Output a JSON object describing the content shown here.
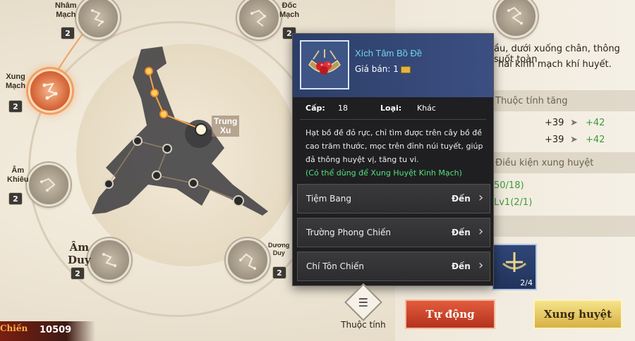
{
  "nodes": {
    "nham_mach": {
      "label": "Nhâm\nMạch",
      "level": "2"
    },
    "doc_mach": {
      "label": "Đốc\nMạch",
      "level": "2"
    },
    "xung_mach": {
      "label": "Xung\nMạch",
      "level": "2"
    },
    "am_khieu": {
      "label": "Âm\nKhiêu",
      "level": "2"
    },
    "am_duy": {
      "label": "Âm\nDuy",
      "level": "2"
    },
    "duong_duy": {
      "label": "Dương\nDuy",
      "level": "2"
    },
    "trung_xu": {
      "label": "Trung\nXu"
    }
  },
  "background": {
    "desc_line1": "ầu, dưới xuống chân, thông suốt toàn",
    "desc_line2": "hai kinh mạch khí huyết.",
    "section1": "Thuộc tính tăng",
    "stat1_from": "+39",
    "stat1_to": "+42",
    "stat2_from": "+39",
    "stat2_to": "+42",
    "section2": "Điều kiện xung huyệt",
    "cond1": "50/18)",
    "cond2": "Lv1(2/1)",
    "thumb_count": "2/4"
  },
  "popup": {
    "item_name": "Xích Tâm Bồ Đề",
    "price_label": "Giá bán: 1",
    "level_label": "Cấp:",
    "level_value": "18",
    "type_label": "Loại:",
    "type_value": "Khác",
    "description": "Hạt bồ đề đỏ rực, chỉ tìm được trên cây bồ đề cao trăm thước, mọc trên đỉnh núi tuyết, giúp đả thông huyệt vị, tăng tu vi.",
    "note": "(Có thể dùng để Xung Huyệt Kinh Mạch)",
    "routes": [
      {
        "name": "Tiệm Bang",
        "go": "Đến"
      },
      {
        "name": "Trường Phong Chiến",
        "go": "Đến"
      },
      {
        "name": "Chí Tôn Chiến",
        "go": "Đến"
      }
    ]
  },
  "bottom": {
    "attr_label": "Thuộc tính",
    "auto_label": "Tự động",
    "xung_label": "Xung huyệt",
    "power_tag": "Chiến",
    "power_value": "10509"
  },
  "colors": {
    "accent_orange": "#d86a3c",
    "popup_bg": "#1f1f22",
    "item_name": "#6fd3ef",
    "note_green": "#53e07a",
    "stat_green": "#3f9b3a"
  }
}
